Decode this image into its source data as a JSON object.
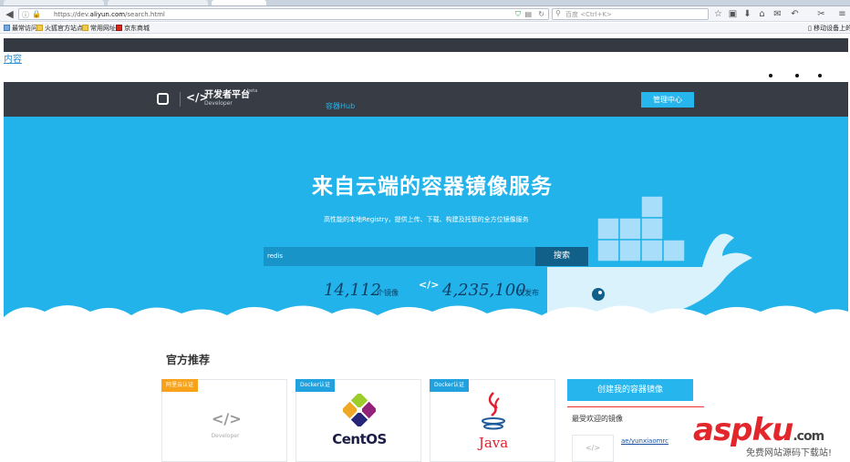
{
  "browser": {
    "url_prefix": "https://dev.",
    "url_domain": "aliyun.com",
    "url_suffix": "/search.html",
    "search_placeholder": "百度 <Ctrl+K>",
    "bookmarks": [
      "最常访问",
      "火狐官方站点",
      "常用网址",
      "京东商城"
    ],
    "bookmark_right": "移动设备上的书"
  },
  "page": {
    "skip_link": "内容",
    "header": {
      "brand": "开发者平台",
      "brand_sub": "Developer",
      "beta": "beta",
      "nav_hub": "容器Hub",
      "admin_button": "管理中心"
    },
    "hero": {
      "title": "来自云端的容器镜像服务",
      "subtitle": "高性能的本地Registry，提供上传、下载、构建及托管的全方位镜像服务",
      "search_value": "redis",
      "search_button": "搜索",
      "images_count": "14,112",
      "images_unit": "个镜像",
      "pulls_count": "4,235,100",
      "pulls_unit": "次发布"
    },
    "section_title": "官方推荐",
    "cards": [
      {
        "badge": "阿里云认证",
        "label": "Developer"
      },
      {
        "badge": "Docker认证",
        "label": "CentOS"
      },
      {
        "badge": "Docker认证",
        "label": "Java"
      }
    ],
    "sidebar": {
      "create_button": "创建我的容器镜像",
      "popular_title": "最受欢迎的镜像",
      "popular_link": "ae/yunxiaomrc"
    }
  },
  "watermark": {
    "main": "aspku",
    "domain": ".com",
    "sub": "免费网站源码下载站!"
  },
  "colors": {
    "hero_blue": "#21b3e9",
    "header_dark": "#373c45",
    "accent": "#26b5ec",
    "badge_official": "#f7a21a",
    "badge_docker": "#21a1dd"
  }
}
